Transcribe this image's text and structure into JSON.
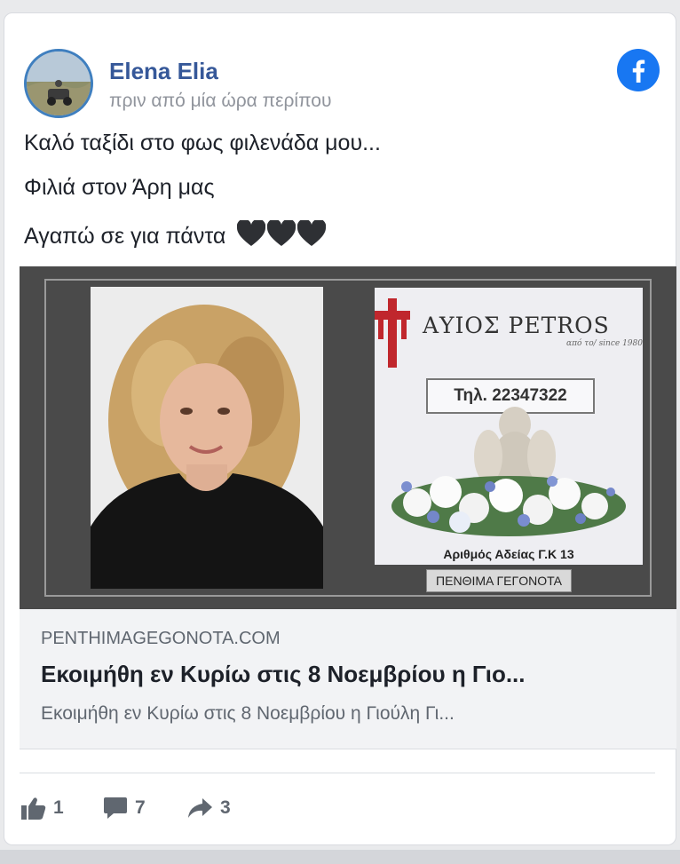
{
  "post": {
    "author": "Elena Elia",
    "time": "πριν από μία ώρα περίπου",
    "lines": [
      "Καλό ταξίδι στο φως φιλενάδα μου...",
      "Φιλιά στον Άρη μας",
      "Αγαπώ σε για πάντα"
    ],
    "emoji": "black-heart x3"
  },
  "link_preview": {
    "image": {
      "ad_brand": "ΑΥΙΟΣ PETROS",
      "ad_since": "από το/ since 1980",
      "ad_phone": "Τηλ. 22347322",
      "ad_license": "Αριθμός Αδείας Γ.Κ 13",
      "ad_tag": "ΠΕΝΘΙΜΑ ΓΕΓΟΝΟΤΑ"
    },
    "domain": "PENTHIMAGEGONOTA.COM",
    "title": "Εκοιμήθη εν Κυρίω στις 8 Νοεμβρίου η Γιο...",
    "description": "Εκοιμήθη εν Κυρίω στις 8 Νοεμβρίου η Γιούλη Γι..."
  },
  "stats": {
    "likes": "1",
    "comments": "7",
    "shares": "3"
  },
  "colors": {
    "author": "#365899",
    "facebook": "#1877f2",
    "muted": "#90949c",
    "cross": "#c0272d"
  },
  "icons": [
    "facebook-icon",
    "like-icon",
    "comment-icon",
    "share-icon",
    "black-heart-icon",
    "cross-icon"
  ]
}
